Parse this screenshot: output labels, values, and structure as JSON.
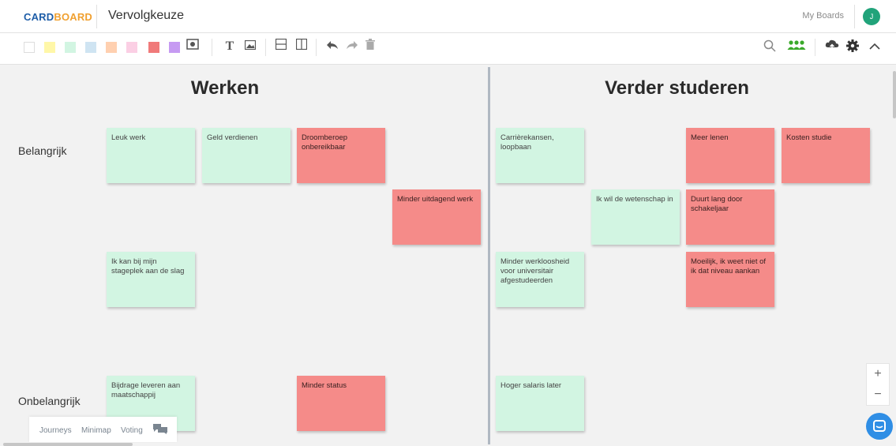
{
  "header": {
    "logo_part1": "CARD",
    "logo_part2": "BOARD",
    "board_title": "Vervolgkeuze",
    "my_boards": "My Boards",
    "avatar_initial": "J"
  },
  "colors": {
    "accent": "#21a37a",
    "logo_blue": "#1f5ea8",
    "logo_orange": "#f0a030",
    "note_green": "#d2f5e2",
    "note_red": "#f58b89",
    "palette": [
      "#ffffff",
      "#fff7a8",
      "#d2f5e2",
      "#cfe4f2",
      "#ffd0b0",
      "#fbcfe4",
      "#f07a7a",
      "#c69af2"
    ]
  },
  "toolbar": {
    "icons": [
      "photo-icon",
      "text-icon",
      "image-icon",
      "horizontal-split-icon",
      "vertical-split-icon",
      "undo-icon",
      "redo-icon",
      "trash-icon",
      "search-icon",
      "users-icon",
      "cloud-upload-icon",
      "gear-icon",
      "chevron-up-icon"
    ]
  },
  "canvas": {
    "columns": [
      "Werken",
      "Verder studeren"
    ],
    "rows": [
      "Belangrijk",
      "Onbelangrijk"
    ],
    "notes": {
      "leuk_werk": "Leuk werk",
      "geld_verdienen": "Geld verdienen",
      "droomberoep": "Droomberoep onbereikbaar",
      "minder_uitdagend": "Minder uitdagend werk",
      "stageplek": "Ik kan bij mijn stageplek aan de slag",
      "bijdrage": "Bijdrage leveren aan maatschappij",
      "minder_status": "Minder status",
      "carriere": "Carrièrekansen, loopbaan",
      "meer_lenen": "Meer lenen",
      "kosten_studie": "Kosten studie",
      "wetenschap": "Ik wil de wetenschap in",
      "duurt_lang": "Duurt lang door schakeljaar",
      "werkloosheid": "Minder werkloosheid voor universitair afgestudeerden",
      "moeilijk": "Moeilijk, ik weet niet of ik dat niveau aankan",
      "hoger_salaris": "Hoger salaris later"
    }
  },
  "bottom": {
    "journeys": "Journeys",
    "minimap": "Minimap",
    "voting": "Voting"
  },
  "zoom": {
    "plus": "+",
    "minus": "−"
  }
}
